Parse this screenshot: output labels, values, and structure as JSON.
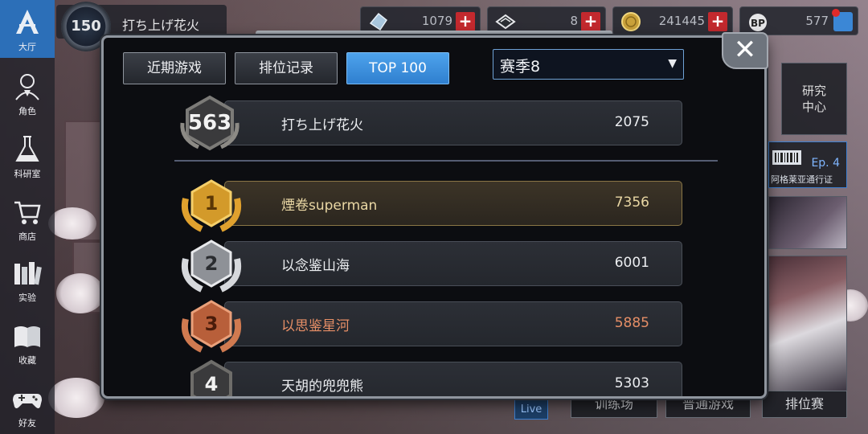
{
  "sidebar": {
    "items": [
      {
        "label": "大厅",
        "icon": "lobby-icon",
        "active": true
      },
      {
        "label": "角色",
        "icon": "character-icon"
      },
      {
        "label": "科研室",
        "icon": "flask-icon"
      },
      {
        "label": "商店",
        "icon": "cart-icon"
      },
      {
        "label": "实验",
        "icon": "books-icon"
      },
      {
        "label": "收藏",
        "icon": "open-book-icon"
      },
      {
        "label": "好友",
        "icon": "gamepad-icon"
      }
    ]
  },
  "player": {
    "level": "150",
    "name": "打ち上げ花火"
  },
  "resources": [
    {
      "icon": "crystal-icon",
      "value": "1079"
    },
    {
      "icon": "ticket-icon",
      "value": "8"
    },
    {
      "icon": "coin-icon",
      "value": "241445"
    },
    {
      "icon": "bp-icon",
      "value": "577"
    }
  ],
  "right_panel": {
    "research_label": "研究中心",
    "pass_episode": "Ep. 4",
    "pass_label": "阿格莱亚通行证",
    "buttons": [
      "训练场",
      "普通游戏",
      "排位赛"
    ],
    "live_label": "Live"
  },
  "modal": {
    "tabs": [
      {
        "label": "近期游戏",
        "active": false
      },
      {
        "label": "排位记录",
        "active": false
      },
      {
        "label": "TOP 100",
        "active": true
      }
    ],
    "season": {
      "selected": "赛季8"
    },
    "close_label": "✕",
    "my_rank": {
      "rank": "563",
      "name": "打ち上げ花火",
      "score": "2075"
    },
    "leaderboard": [
      {
        "rank": "1",
        "name": "煙卷superman",
        "score": "7356",
        "tier": "gold"
      },
      {
        "rank": "2",
        "name": "以念鉴山海",
        "score": "6001",
        "tier": "silver"
      },
      {
        "rank": "3",
        "name": "以思鉴星河",
        "score": "5885",
        "tier": "bronze"
      },
      {
        "rank": "4",
        "name": "天胡的兜兜熊",
        "score": "5303",
        "tier": "plain"
      }
    ]
  },
  "colors": {
    "accent_blue": "#2f7fcf",
    "gold": "#d39a2a",
    "silver": "#c9ccd1",
    "bronze": "#c4673f",
    "plus_red": "#c3292e"
  }
}
